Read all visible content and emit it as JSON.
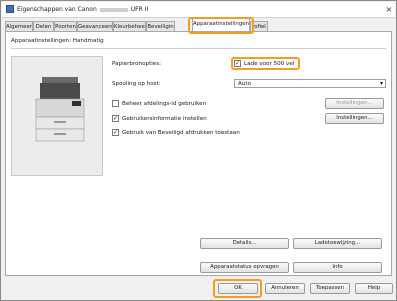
{
  "window": {
    "title_prefix": "Eigenschappen van Canon",
    "title_suffix": "UFR II"
  },
  "tabs": [
    {
      "label": "Algemeen"
    },
    {
      "label": "Delen"
    },
    {
      "label": "Poorten"
    },
    {
      "label": "Geavanceerd"
    },
    {
      "label": "Kleurbeheer"
    },
    {
      "label": "Beveiligin"
    },
    {
      "label": "Apparaatinstellingen"
    },
    {
      "label": "rofiel"
    }
  ],
  "active_tab": "Apparaatinstellingen",
  "panel": {
    "header": "Apparaatinstellingen: Handmatig",
    "paper_source_label": "Papierbronopties:",
    "paper_source_option": "Lade voor 500 vel",
    "spooling_label": "Spooling op host:",
    "spooling_value": "Auto",
    "dept_id_label": "Beheer afdelings-id gebruiken",
    "dept_id_settings": "Instellingen...",
    "user_info_label": "Gebruikersinformatie instellen",
    "user_info_settings": "Instellingen...",
    "secure_print_label": "Gebruik van Beveiligd afdrukken toestaan",
    "details_button": "Details...",
    "paper_assign_button": "Ladetoewijzing...",
    "device_status_button": "Apparaatstatus opvragen",
    "info_button": "Info"
  },
  "footer": {
    "ok": "OK",
    "cancel": "Annuleren",
    "apply": "Toepassen",
    "help": "Help"
  },
  "colors": {
    "highlight": "#f0a020"
  },
  "icons": {
    "close": "×",
    "check": "✓",
    "dropdown_arrow": "▾"
  }
}
